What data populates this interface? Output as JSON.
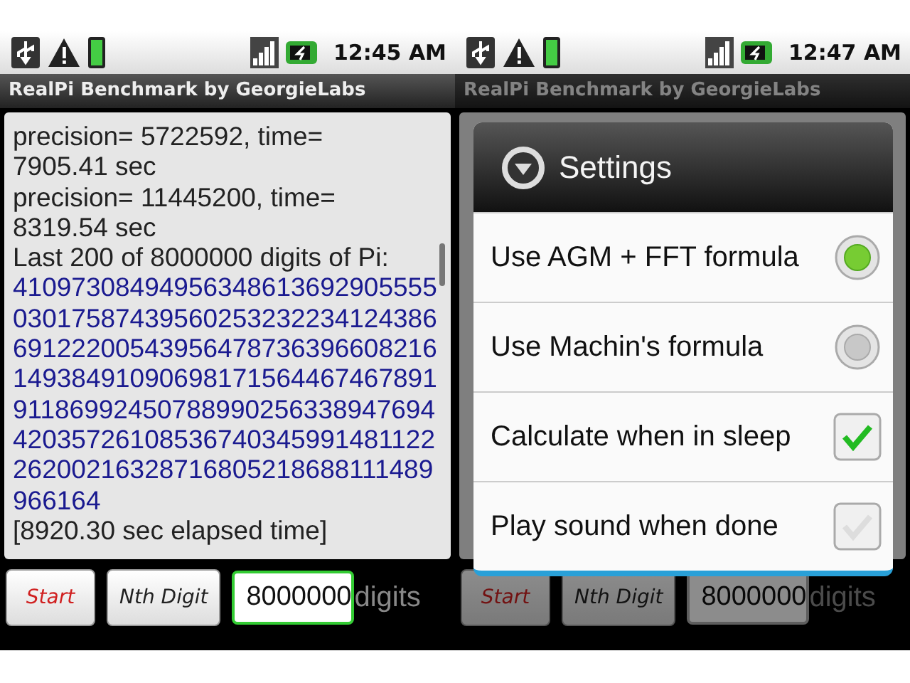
{
  "screens": [
    {
      "status_bar": {
        "time": "12:45 AM"
      },
      "title": "RealPi Benchmark by GeorgieLabs",
      "dimmed": false,
      "log": [
        {
          "kind": "text",
          "text": "precision= 5722592, time="
        },
        {
          "kind": "text",
          "text": "7905.41 sec"
        },
        {
          "kind": "text",
          "text": "precision= 11445200, time="
        },
        {
          "kind": "text",
          "text": "8319.54 sec"
        },
        {
          "kind": "text",
          "text": "Last 200 of 8000000 digits of Pi:"
        },
        {
          "kind": "digits",
          "text": "41097308494956348613692905555"
        },
        {
          "kind": "digits",
          "text": "03017587439560253232234124386"
        },
        {
          "kind": "digits",
          "text": "69122200543956478736396608216"
        },
        {
          "kind": "digits",
          "text": "14938491090698171564467467891"
        },
        {
          "kind": "digits",
          "text": "91186992450788990256338947694"
        },
        {
          "kind": "digits",
          "text": "42035726108536740345991481122"
        },
        {
          "kind": "digits",
          "text": "26200216328716805218688111489"
        },
        {
          "kind": "digits",
          "text": "966164"
        },
        {
          "kind": "text",
          "text": "[8920.30 sec elapsed time]"
        }
      ],
      "buttons": [
        {
          "label": "Start",
          "kind": "start"
        },
        {
          "label": "Nth Digit",
          "kind": "plain"
        }
      ],
      "digits_field": {
        "value": "8000000",
        "focused": true
      },
      "digits_label": "digits"
    },
    {
      "status_bar": {
        "time": "12:47 AM"
      },
      "title": "RealPi Benchmark by GeorgieLabs",
      "dimmed": true,
      "buttons": [
        {
          "label": "Start",
          "kind": "start"
        },
        {
          "label": "Nth Digit",
          "kind": "plain"
        }
      ],
      "digits_field": {
        "value": "8000000",
        "focused": false
      },
      "digits_label": "digits",
      "dialog": {
        "title": "Settings",
        "options": [
          {
            "kind": "radio",
            "label": "Use AGM + FFT formula",
            "selected": true
          },
          {
            "kind": "radio",
            "label": "Use Machin's formula",
            "selected": false
          },
          {
            "kind": "checkbox",
            "label": "Calculate when in sleep",
            "checked": true
          },
          {
            "kind": "checkbox",
            "label": "Play sound when done",
            "checked": false
          }
        ]
      }
    }
  ]
}
